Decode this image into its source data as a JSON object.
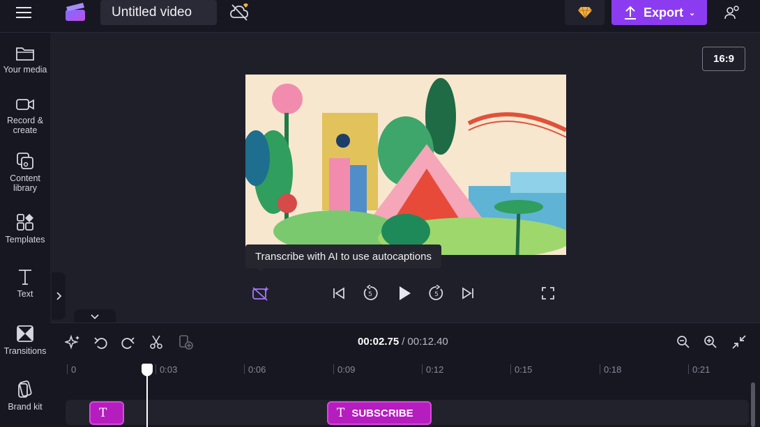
{
  "header": {
    "title_value": "Untitled video",
    "export_label": "Export",
    "brand_color": "#8c3cf0"
  },
  "sidebar": {
    "items": [
      {
        "label": "Your media",
        "icon": "folder-icon"
      },
      {
        "label": "Record &\ncreate",
        "icon": "camera-icon"
      },
      {
        "label": "Content\nlibrary",
        "icon": "content-library-icon"
      },
      {
        "label": "Templates",
        "icon": "templates-icon"
      },
      {
        "label": "Text",
        "icon": "text-icon"
      },
      {
        "label": "Transitions",
        "icon": "transitions-icon"
      },
      {
        "label": "Brand kit",
        "icon": "brand-kit-icon"
      }
    ]
  },
  "preview": {
    "aspect_ratio": "16:9",
    "tooltip": "Transcribe with AI to use autocaptions"
  },
  "timeline": {
    "current_time": "00:02.75",
    "separator": "/",
    "total_time": "00:12.40",
    "ticks": [
      "0",
      "0:03",
      "0:06",
      "0:09",
      "0:12",
      "0:15",
      "0:18",
      "0:21"
    ],
    "clips": [
      {
        "label": ""
      },
      {
        "label": "SUBSCRIBE"
      }
    ],
    "clip_color": "#b51dbe"
  }
}
